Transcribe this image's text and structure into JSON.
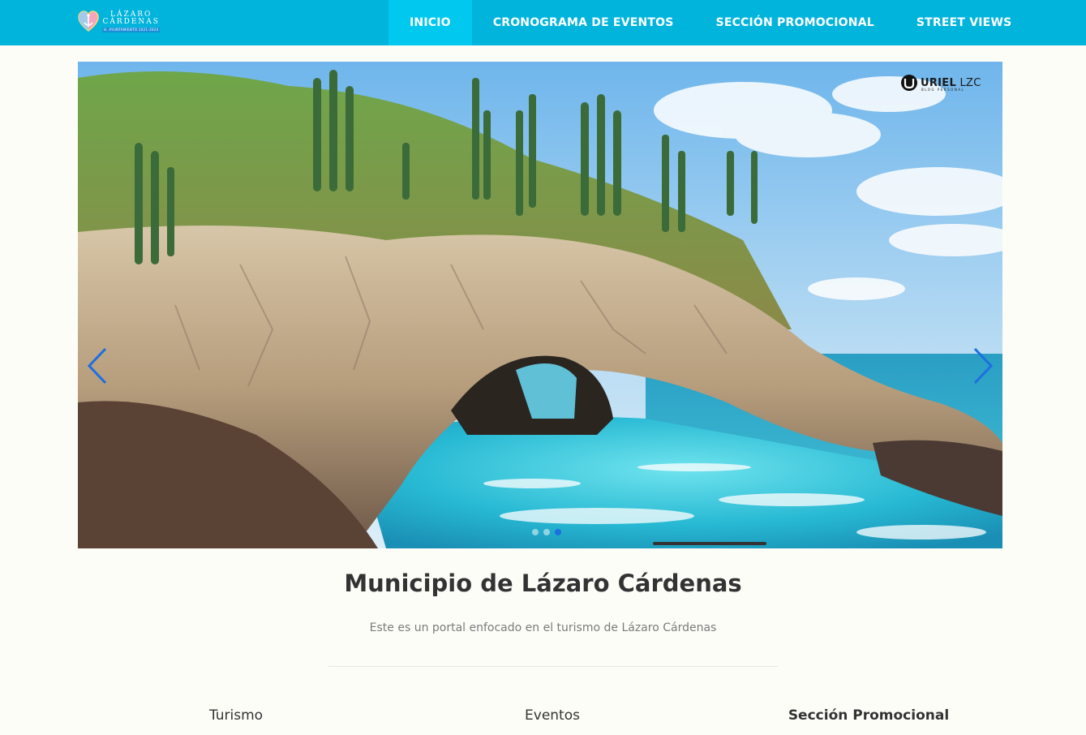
{
  "navbar": {
    "brand": {
      "line1": "LÁZARO",
      "line2": "CÁRDENAS",
      "line3": "H. AYUNTAMIENTO 2021-2024",
      "logo_icon": "heart-anchor-logo"
    },
    "items": [
      {
        "label": "INICIO",
        "active": true
      },
      {
        "label": "CRONOGRAMA DE EVENTOS",
        "active": false
      },
      {
        "label": "SECCIÓN PROMOCIONAL",
        "active": false
      },
      {
        "label": "STREET VIEWS",
        "active": false
      }
    ],
    "color": "#00b4dc",
    "active_color": "#00c8ee"
  },
  "carousel": {
    "watermark": {
      "bold": "URIEL",
      "rest": " LZC",
      "sub": "BLOG PERSONAL"
    },
    "prev_icon": "chevron-left-icon",
    "next_icon": "chevron-right-icon",
    "indicator_count": 3,
    "active_indicator": 2,
    "arrow_color": "#1e6fe0"
  },
  "main": {
    "title": "Municipio de Lázaro Cárdenas",
    "subtitle": "Este es un portal enfocado en el turismo de Lázaro Cárdenas"
  },
  "sections": [
    {
      "label": "Turismo"
    },
    {
      "label": "Eventos"
    },
    {
      "label": "Sección Promocional"
    }
  ]
}
